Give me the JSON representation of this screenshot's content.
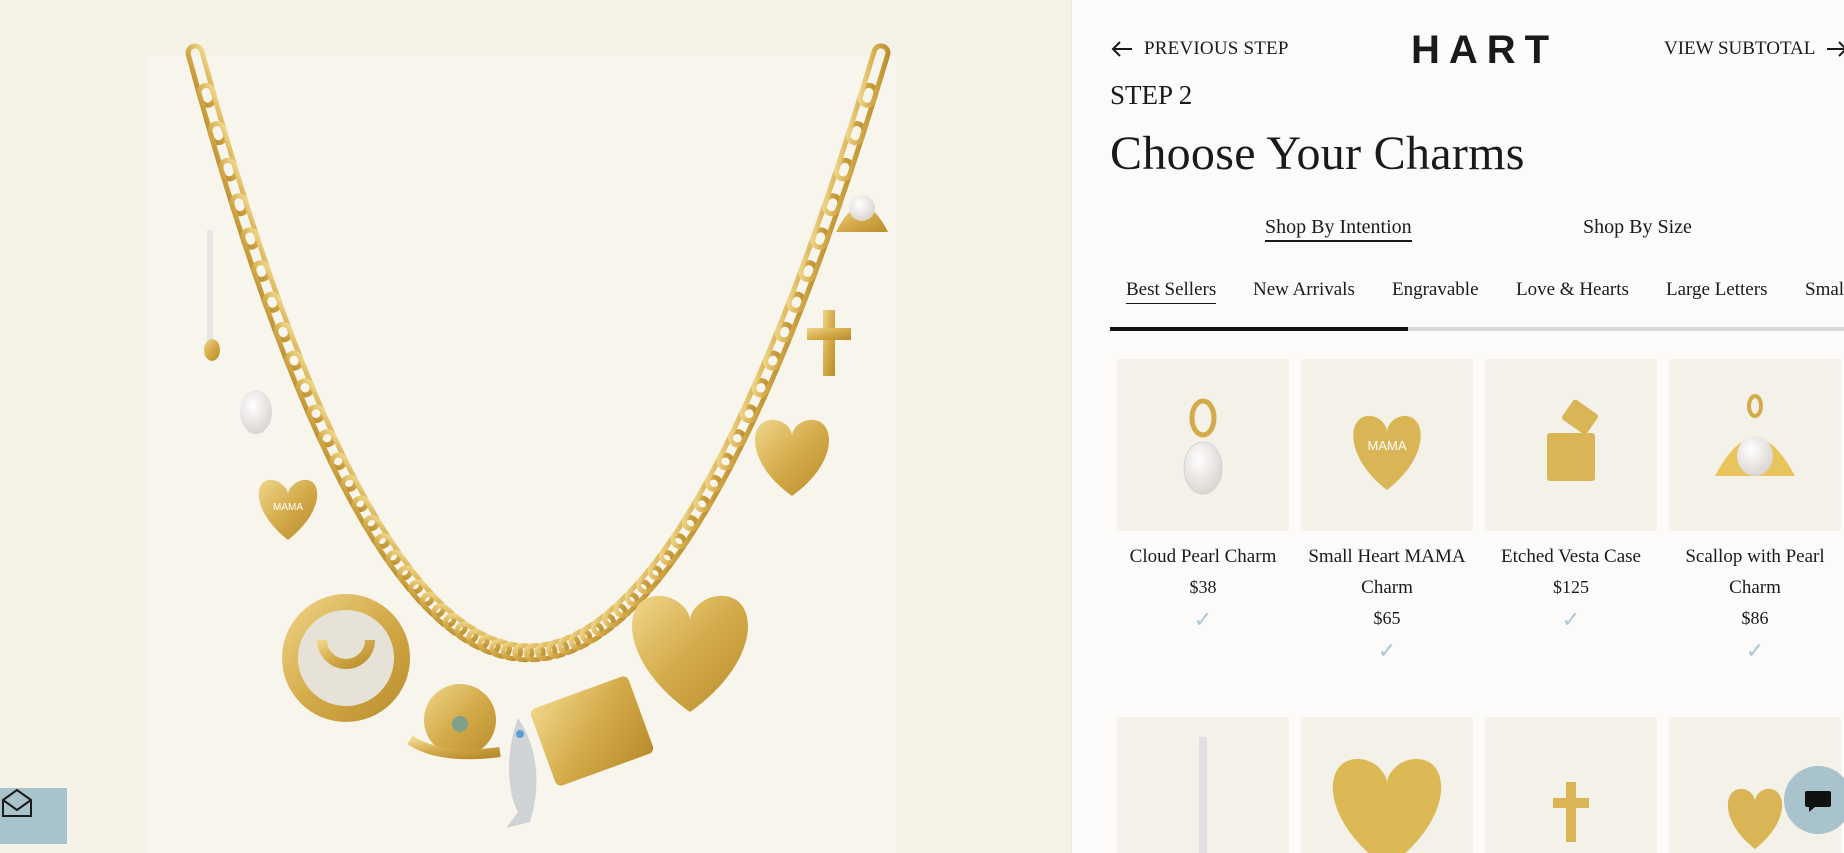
{
  "header": {
    "prev_step": "PREVIOUS STEP",
    "brand": "HART",
    "view_subtotal": "VIEW SUBTOTAL"
  },
  "step": {
    "label": "STEP 2",
    "title": "Choose Your Charms"
  },
  "mode_tabs": [
    {
      "label": "Shop By Intention",
      "active": true
    },
    {
      "label": "Shop By Size",
      "active": false
    }
  ],
  "category_tabs": [
    {
      "label": "Best Sellers",
      "active": true
    },
    {
      "label": "New Arrivals",
      "active": false
    },
    {
      "label": "Engravable",
      "active": false
    },
    {
      "label": "Love & Hearts",
      "active": false
    },
    {
      "label": "Large Letters",
      "active": false
    },
    {
      "label": "Smal",
      "active": false
    }
  ],
  "category_scroll_progress": 0.405,
  "products": [
    {
      "name": "Cloud Pearl Charm",
      "price": "$38",
      "check": "✓",
      "icon": "pearl-charm"
    },
    {
      "name": "Small Heart MAMA Charm",
      "price": "$65",
      "check": "✓",
      "icon": "heart-mama-charm"
    },
    {
      "name": "Etched Vesta Case",
      "price": "$125",
      "check": "✓",
      "icon": "vesta-case-charm"
    },
    {
      "name": "Scallop with Pearl Charm",
      "price": "$86",
      "check": "✓",
      "icon": "scallop-pearl-charm"
    },
    {
      "name": "",
      "price": "",
      "check": "",
      "icon": "bar-charm"
    },
    {
      "name": "",
      "price": "",
      "check": "",
      "icon": "large-heart-charm"
    },
    {
      "name": "",
      "price": "",
      "check": "",
      "icon": "cross-charm"
    },
    {
      "name": "",
      "price": "",
      "check": "",
      "icon": "small-heart-charm"
    }
  ],
  "colors": {
    "accent_check": "#a9c6d4",
    "gold": "#d9b555",
    "panel_bg": "#fcfbf9",
    "preview_bg": "#f5f2e8"
  },
  "icons": {
    "prev": "arrow-left-icon",
    "next": "arrow-right-icon",
    "newsletter": "envelope-icon",
    "chat": "chat-bubble-icon"
  }
}
